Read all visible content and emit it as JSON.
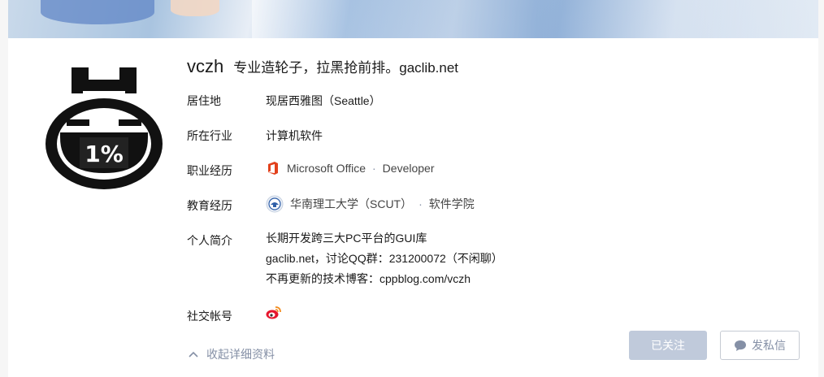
{
  "profile": {
    "name": "vczh",
    "headline": "专业造轮子，拉黑抢前排。gaclib.net",
    "avatar_text": "1%"
  },
  "fields": {
    "location": {
      "label": "居住地",
      "value": "现居西雅图（Seattle）"
    },
    "industry": {
      "label": "所在行业",
      "value": "计算机软件"
    },
    "career": {
      "label": "职业经历",
      "company": "Microsoft Office",
      "separator": "·",
      "position": "Developer"
    },
    "education": {
      "label": "教育经历",
      "school": "华南理工大学（SCUT）",
      "separator": "·",
      "major": "软件学院"
    },
    "bio": {
      "label": "个人简介",
      "lines": [
        "长期开发跨三大PC平台的GUI库",
        "gaclib.net，讨论QQ群：231200072（不闲聊）",
        "不再更新的技术博客：cppblog.com/vczh"
      ]
    },
    "social": {
      "label": "社交帐号"
    }
  },
  "actions": {
    "collapse_label": "收起详细资料",
    "followed_label": "已关注",
    "message_label": "发私信"
  },
  "icons": {
    "company": "microsoft-office-icon",
    "school": "school-emblem-icon",
    "social": "weibo-icon",
    "collapse": "chevron-up-icon",
    "message": "chat-bubble-icon"
  },
  "colors": {
    "office": "#e2411c",
    "weibo": "#e6162d",
    "followed_bg": "#c0cadb",
    "muted": "#8590a6"
  }
}
